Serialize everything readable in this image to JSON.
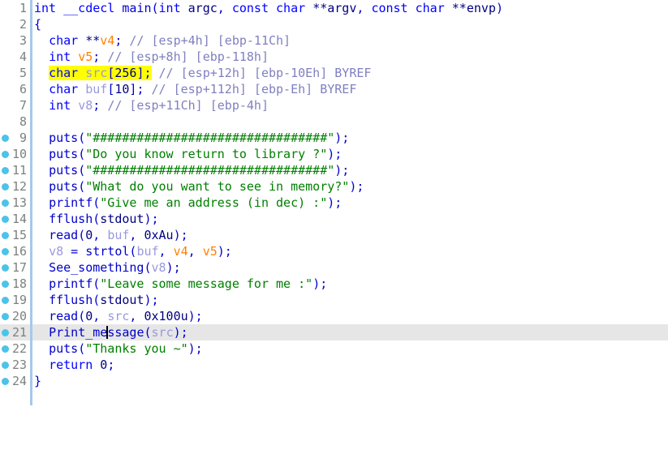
{
  "app": {
    "kind": "decompiler-pseudocode-view",
    "background": "#ffffff",
    "gutter_bar_color": "#a8c8e8",
    "breakpoint_color": "#4cc3e8",
    "highlight_search_color": "#ffff00",
    "current_line_color": "#e6e6e6"
  },
  "cursor": {
    "line": 21,
    "column": 12,
    "before": "  Print_me",
    "after": "ssage"
  },
  "lines": [
    {
      "no": "1",
      "breakpoint": false,
      "current": false
    },
    {
      "no": "2",
      "breakpoint": false,
      "current": false
    },
    {
      "no": "3",
      "breakpoint": false,
      "current": false
    },
    {
      "no": "4",
      "breakpoint": false,
      "current": false
    },
    {
      "no": "5",
      "breakpoint": false,
      "current": false
    },
    {
      "no": "6",
      "breakpoint": false,
      "current": false
    },
    {
      "no": "7",
      "breakpoint": false,
      "current": false
    },
    {
      "no": "8",
      "breakpoint": false,
      "current": false
    },
    {
      "no": "9",
      "breakpoint": true,
      "current": false
    },
    {
      "no": "10",
      "breakpoint": true,
      "current": false
    },
    {
      "no": "11",
      "breakpoint": true,
      "current": false
    },
    {
      "no": "12",
      "breakpoint": true,
      "current": false
    },
    {
      "no": "13",
      "breakpoint": true,
      "current": false
    },
    {
      "no": "14",
      "breakpoint": true,
      "current": false
    },
    {
      "no": "15",
      "breakpoint": true,
      "current": false
    },
    {
      "no": "16",
      "breakpoint": true,
      "current": false
    },
    {
      "no": "17",
      "breakpoint": true,
      "current": false
    },
    {
      "no": "18",
      "breakpoint": true,
      "current": false
    },
    {
      "no": "19",
      "breakpoint": true,
      "current": false
    },
    {
      "no": "20",
      "breakpoint": true,
      "current": false
    },
    {
      "no": "21",
      "breakpoint": true,
      "current": true
    },
    {
      "no": "22",
      "breakpoint": true,
      "current": false
    },
    {
      "no": "23",
      "breakpoint": true,
      "current": false
    },
    {
      "no": "24",
      "breakpoint": true,
      "current": false
    }
  ],
  "code": {
    "line1": "int __cdecl main(int argc, const char **argv, const char **envp)",
    "line2": "{",
    "line3": "  char **v4; // [esp+4h] [ebp-11Ch]",
    "line4": "  int v5; // [esp+8h] [ebp-118h]",
    "line5": "  char src[256]; // [esp+12h] [ebp-10Eh] BYREF",
    "line6": "  char buf[10]; // [esp+112h] [ebp-Eh] BYREF",
    "line7": "  int v8; // [esp+11Ch] [ebp-4h]",
    "line8": "",
    "line9": "  puts(\"################################\");",
    "line10": "  puts(\"Do you know return to library ?\");",
    "line11": "  puts(\"################################\");",
    "line12": "  puts(\"What do you want to see in memory?\");",
    "line13": "  printf(\"Give me an address (in dec) :\");",
    "line14": "  fflush(stdout);",
    "line15": "  read(0, buf, 0xAu);",
    "line16": "  v8 = strtol(buf, v4, v5);",
    "line17": "  See_something(v8);",
    "line18": "  printf(\"Leave some message for me :\");",
    "line19": "  fflush(stdout);",
    "line20": "  read(0, src, 0x100u);",
    "line21": "  Print_message(src);",
    "line22": "  puts(\"Thanks you ~\");",
    "line23": "  return 0;",
    "line24": "}"
  },
  "tokens": {
    "kw_int": "int",
    "kw_char": "char",
    "kw_const": "const",
    "kw_return": "return",
    "cdecl": "__cdecl",
    "fn_main": "main",
    "arg_argc": "argc",
    "arg_argv": "argv",
    "arg_envp": "envp",
    "var_v4": "v4",
    "var_v5": "v5",
    "var_v8": "v8",
    "var_src": "src",
    "var_buf": "buf",
    "fn_puts": "puts",
    "fn_printf": "printf",
    "fn_fflush": "fflush",
    "fn_read": "read",
    "fn_strtol": "strtol",
    "fn_see_something": "See_something",
    "fn_print_message": "Print_message",
    "sym_stdout": "stdout",
    "num_0": "0",
    "num_10": "10",
    "num_256": "256",
    "num_0xAu": "0xAu",
    "num_0x100u": "0x100u",
    "comment3": "// [esp+4h] [ebp-11Ch]",
    "comment4": "// [esp+8h] [ebp-118h]",
    "comment5": "// [esp+12h] [ebp-10Eh] BYREF",
    "comment6": "// [esp+112h] [ebp-Eh] BYREF",
    "comment7": "// [esp+11Ch] [ebp-4h]",
    "str_hashes": "\"################################\"",
    "str_do_you_know": "\"Do you know return to library ?\"",
    "str_what_do_you": "\"What do you want to see in memory?\"",
    "str_give_me": "\"Give me an address (in dec) :\"",
    "str_leave_some": "\"Leave some message for me :\"",
    "str_thanks": "\"Thanks you ~\"",
    "p_open": "(",
    "p_close": ")",
    "p_semi": ";",
    "p_comma": ", ",
    "p_brace_open": "{",
    "p_brace_close": "}",
    "p_stars": "**",
    "p_star_argv": "**",
    "p_eq": " = ",
    "p_sp": " ",
    "p_indent": "  ",
    "p_bracket_open": "[",
    "p_bracket_close": "]",
    "p_close_semi": ");",
    "p_comma_sp": ", "
  }
}
